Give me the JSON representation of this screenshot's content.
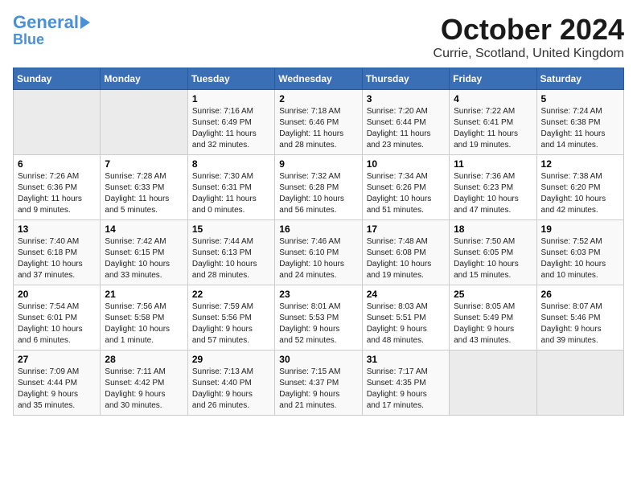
{
  "logo": {
    "line1": "General",
    "line2": "Blue"
  },
  "title": "October 2024",
  "subtitle": "Currie, Scotland, United Kingdom",
  "days_of_week": [
    "Sunday",
    "Monday",
    "Tuesday",
    "Wednesday",
    "Thursday",
    "Friday",
    "Saturday"
  ],
  "weeks": [
    [
      {
        "day": "",
        "info": ""
      },
      {
        "day": "",
        "info": ""
      },
      {
        "day": "1",
        "info": "Sunrise: 7:16 AM\nSunset: 6:49 PM\nDaylight: 11 hours\nand 32 minutes."
      },
      {
        "day": "2",
        "info": "Sunrise: 7:18 AM\nSunset: 6:46 PM\nDaylight: 11 hours\nand 28 minutes."
      },
      {
        "day": "3",
        "info": "Sunrise: 7:20 AM\nSunset: 6:44 PM\nDaylight: 11 hours\nand 23 minutes."
      },
      {
        "day": "4",
        "info": "Sunrise: 7:22 AM\nSunset: 6:41 PM\nDaylight: 11 hours\nand 19 minutes."
      },
      {
        "day": "5",
        "info": "Sunrise: 7:24 AM\nSunset: 6:38 PM\nDaylight: 11 hours\nand 14 minutes."
      }
    ],
    [
      {
        "day": "6",
        "info": "Sunrise: 7:26 AM\nSunset: 6:36 PM\nDaylight: 11 hours\nand 9 minutes."
      },
      {
        "day": "7",
        "info": "Sunrise: 7:28 AM\nSunset: 6:33 PM\nDaylight: 11 hours\nand 5 minutes."
      },
      {
        "day": "8",
        "info": "Sunrise: 7:30 AM\nSunset: 6:31 PM\nDaylight: 11 hours\nand 0 minutes."
      },
      {
        "day": "9",
        "info": "Sunrise: 7:32 AM\nSunset: 6:28 PM\nDaylight: 10 hours\nand 56 minutes."
      },
      {
        "day": "10",
        "info": "Sunrise: 7:34 AM\nSunset: 6:26 PM\nDaylight: 10 hours\nand 51 minutes."
      },
      {
        "day": "11",
        "info": "Sunrise: 7:36 AM\nSunset: 6:23 PM\nDaylight: 10 hours\nand 47 minutes."
      },
      {
        "day": "12",
        "info": "Sunrise: 7:38 AM\nSunset: 6:20 PM\nDaylight: 10 hours\nand 42 minutes."
      }
    ],
    [
      {
        "day": "13",
        "info": "Sunrise: 7:40 AM\nSunset: 6:18 PM\nDaylight: 10 hours\nand 37 minutes."
      },
      {
        "day": "14",
        "info": "Sunrise: 7:42 AM\nSunset: 6:15 PM\nDaylight: 10 hours\nand 33 minutes."
      },
      {
        "day": "15",
        "info": "Sunrise: 7:44 AM\nSunset: 6:13 PM\nDaylight: 10 hours\nand 28 minutes."
      },
      {
        "day": "16",
        "info": "Sunrise: 7:46 AM\nSunset: 6:10 PM\nDaylight: 10 hours\nand 24 minutes."
      },
      {
        "day": "17",
        "info": "Sunrise: 7:48 AM\nSunset: 6:08 PM\nDaylight: 10 hours\nand 19 minutes."
      },
      {
        "day": "18",
        "info": "Sunrise: 7:50 AM\nSunset: 6:05 PM\nDaylight: 10 hours\nand 15 minutes."
      },
      {
        "day": "19",
        "info": "Sunrise: 7:52 AM\nSunset: 6:03 PM\nDaylight: 10 hours\nand 10 minutes."
      }
    ],
    [
      {
        "day": "20",
        "info": "Sunrise: 7:54 AM\nSunset: 6:01 PM\nDaylight: 10 hours\nand 6 minutes."
      },
      {
        "day": "21",
        "info": "Sunrise: 7:56 AM\nSunset: 5:58 PM\nDaylight: 10 hours\nand 1 minute."
      },
      {
        "day": "22",
        "info": "Sunrise: 7:59 AM\nSunset: 5:56 PM\nDaylight: 9 hours\nand 57 minutes."
      },
      {
        "day": "23",
        "info": "Sunrise: 8:01 AM\nSunset: 5:53 PM\nDaylight: 9 hours\nand 52 minutes."
      },
      {
        "day": "24",
        "info": "Sunrise: 8:03 AM\nSunset: 5:51 PM\nDaylight: 9 hours\nand 48 minutes."
      },
      {
        "day": "25",
        "info": "Sunrise: 8:05 AM\nSunset: 5:49 PM\nDaylight: 9 hours\nand 43 minutes."
      },
      {
        "day": "26",
        "info": "Sunrise: 8:07 AM\nSunset: 5:46 PM\nDaylight: 9 hours\nand 39 minutes."
      }
    ],
    [
      {
        "day": "27",
        "info": "Sunrise: 7:09 AM\nSunset: 4:44 PM\nDaylight: 9 hours\nand 35 minutes."
      },
      {
        "day": "28",
        "info": "Sunrise: 7:11 AM\nSunset: 4:42 PM\nDaylight: 9 hours\nand 30 minutes."
      },
      {
        "day": "29",
        "info": "Sunrise: 7:13 AM\nSunset: 4:40 PM\nDaylight: 9 hours\nand 26 minutes."
      },
      {
        "day": "30",
        "info": "Sunrise: 7:15 AM\nSunset: 4:37 PM\nDaylight: 9 hours\nand 21 minutes."
      },
      {
        "day": "31",
        "info": "Sunrise: 7:17 AM\nSunset: 4:35 PM\nDaylight: 9 hours\nand 17 minutes."
      },
      {
        "day": "",
        "info": ""
      },
      {
        "day": "",
        "info": ""
      }
    ]
  ]
}
